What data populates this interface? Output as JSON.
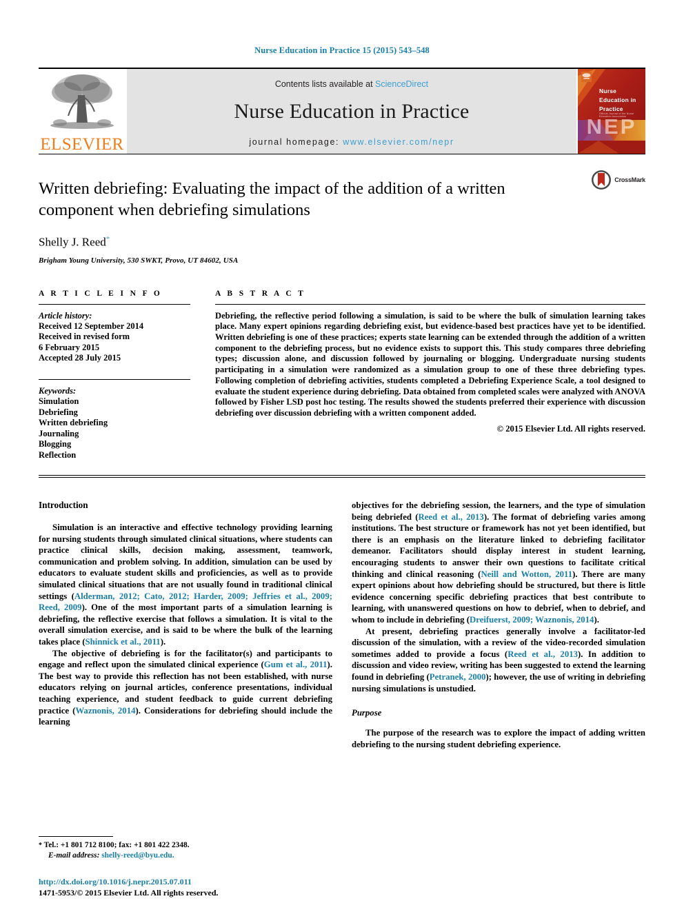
{
  "running_head": "Nurse Education in Practice 15 (2015) 543–548",
  "masthead": {
    "publisher_name": "ELSEVIER",
    "contents_prefix": "Contents lists available at ",
    "contents_link": "ScienceDirect",
    "journal_name": "Nurse Education in Practice",
    "homepage_prefix": "journal homepage: ",
    "homepage_link": "www.elsevier.com/nepr",
    "cover": {
      "title_line1": "Nurse",
      "title_line2": "Education in",
      "title_line3": "Practice",
      "acronym": "NEP",
      "micro_text": "Official Journal of the Nurse Education Association"
    },
    "colors": {
      "link": "#3d9fd0",
      "elsevier_orange": "#ef7d1a",
      "box_gray": "#e3e3e3",
      "cover_red": "#b5241c"
    }
  },
  "article": {
    "title": "Written debriefing: Evaluating the impact of the addition of a written component when debriefing simulations",
    "author": "Shelly J. Reed",
    "author_marker": "*",
    "affiliation": "Brigham Young University, 530 SWKT, Provo, UT 84602, USA",
    "crossmark_label": "CrossMark"
  },
  "article_info": {
    "heading": "A R T I C L E   I N F O",
    "history_label": "Article history:",
    "history": [
      "Received 12 September 2014",
      "Received in revised form",
      "6 February 2015",
      "Accepted 28 July 2015"
    ],
    "keywords_label": "Keywords:",
    "keywords": [
      "Simulation",
      "Debriefing",
      "Written debriefing",
      "Journaling",
      "Blogging",
      "Reflection"
    ]
  },
  "abstract": {
    "heading": "A B S T R A C T",
    "text": "Debriefing, the reflective period following a simulation, is said to be where the bulk of simulation learning takes place. Many expert opinions regarding debriefing exist, but evidence-based best practices have yet to be identified. Written debriefing is one of these practices; experts state learning can be extended through the addition of a written component to the debriefing process, but no evidence exists to support this. This study compares three debriefing types; discussion alone, and discussion followed by journaling or blogging. Undergraduate nursing students participating in a simulation were randomized as a simulation group to one of these three debriefing types. Following completion of debriefing activities, students completed a Debriefing Experience Scale, a tool designed to evaluate the student experience during debriefing. Data obtained from completed scales were analyzed with ANOVA followed by Fisher LSD post hoc testing. The results showed the students preferred their experience with discussion debriefing over discussion debriefing with a written component added.",
    "copyright": "© 2015 Elsevier Ltd. All rights reserved."
  },
  "body": {
    "left_heading": "Introduction",
    "p1_a": "Simulation is an interactive and effective technology providing learning for nursing students through simulated clinical situations, where students can practice clinical skills, decision making, assessment, teamwork, communication and problem solving. In addition, simulation can be used by educators to evaluate student skills and proficiencies, as well as to provide simulated clinical situations that are not usually found in traditional clinical settings (",
    "p1_cite1": "Alderman, 2012; Cato, 2012; Harder, 2009; Jeffries et al., 2009; Reed, 2009",
    "p1_b": "). One of the most important parts of a simulation learning is debriefing, the reflective exercise that follows a simulation. It is vital to the overall simulation exercise, and is said to be where the bulk of the learning takes place (",
    "p1_cite2": "Shinnick et al., 2011",
    "p1_c": ").",
    "p2_a": "The objective of debriefing is for the facilitator(s) and participants to engage and reflect upon the simulated clinical experience (",
    "p2_cite1": "Gum et al., 2011",
    "p2_b": "). The best way to provide this reflection has not been established, with nurse educators relying on journal articles, conference presentations, individual teaching experience, and student feedback to guide current debriefing practice (",
    "p2_cite2": "Waznonis, 2014",
    "p2_c": "). Considerations for debriefing should include the learning",
    "p3_a": "objectives for the debriefing session, the learners, and the type of simulation being debriefed (",
    "p3_cite1": "Reed et al., 2013",
    "p3_b": "). The format of debriefing varies among institutions. The best structure or framework has not yet been identified, but there is an emphasis on the literature linked to debriefing facilitator demeanor. Facilitators should display interest in student learning, encouraging students to answer their own questions to facilitate critical thinking and clinical reasoning (",
    "p3_cite2": "Neill and Wotton, 2011",
    "p3_c": "). There are many expert opinions about how debriefing should be structured, but there is little evidence concerning specific debriefing practices that best contribute to learning, with unanswered questions on how to debrief, when to debrief, and whom to include in debriefing (",
    "p3_cite3": "Dreifuerst, 2009; Waznonis, 2014",
    "p3_d": ").",
    "p4_a": "At present, debriefing practices generally involve a facilitator-led discussion of the simulation, with a review of the video-recorded simulation sometimes added to provide a focus (",
    "p4_cite1": "Reed et al., 2013",
    "p4_b": "). In addition to discussion and video review, writing has been suggested to extend the learning found in debriefing (",
    "p4_cite2": "Petranek, 2000",
    "p4_c": "); however, the use of writing in debriefing nursing simulations is unstudied.",
    "purpose_heading": "Purpose",
    "purpose_p": "The purpose of the research was to explore the impact of adding written debriefing to the nursing student debriefing experience."
  },
  "footnote": {
    "marker": "*",
    "tel_line": "Tel.: +1 801 712 8100; fax: +1 801 422 2348.",
    "email_label": "E-mail address:",
    "email": "shelly-reed@byu.edu."
  },
  "footer": {
    "doi": "http://dx.doi.org/10.1016/j.nepr.2015.07.011",
    "issn": "1471-5953/© 2015 Elsevier Ltd. All rights reserved."
  }
}
